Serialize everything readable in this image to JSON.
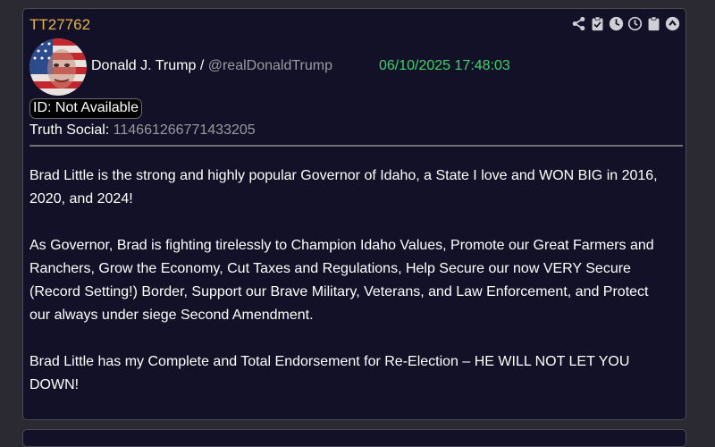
{
  "post": {
    "id": "TT27762",
    "author_name": "Donald J. Trump",
    "separator": " / ",
    "handle": "@realDonaldTrump",
    "timestamp": "06/10/2025 17:48:03",
    "id_label": "ID: Not Available",
    "truth_label": "Truth Social: ",
    "truth_id": "114661266771433205",
    "paragraphs": [
      "Brad Little is the strong and highly popular Governor of Idaho, a State I love and WON BIG in 2016, 2020, and 2024!",
      "As Governor, Brad is fighting tirelessly to Champion Idaho Values, Promote our Great Farmers and Ranchers, Grow the Economy, Cut Taxes and Regulations, Help Secure our now VERY Secure (Record Setting!) Border, Support our Brave Military, Veterans, and Law Enforcement, and Protect our always under siege Second Amendment.",
      "Brad Little has my Complete and Total Endorsement for Re-Election – HE WILL NOT LET YOU DOWN!"
    ]
  },
  "toolbar": {
    "icons": [
      "share-icon",
      "clipboard-check-icon",
      "clock-filled-icon",
      "clock-outline-icon",
      "clipboard-icon",
      "chevron-up-icon"
    ]
  },
  "colors": {
    "id": "#e5b53a",
    "timestamp": "#3cd46a",
    "handle": "#9a9aa2",
    "card_bg": "#131128"
  }
}
